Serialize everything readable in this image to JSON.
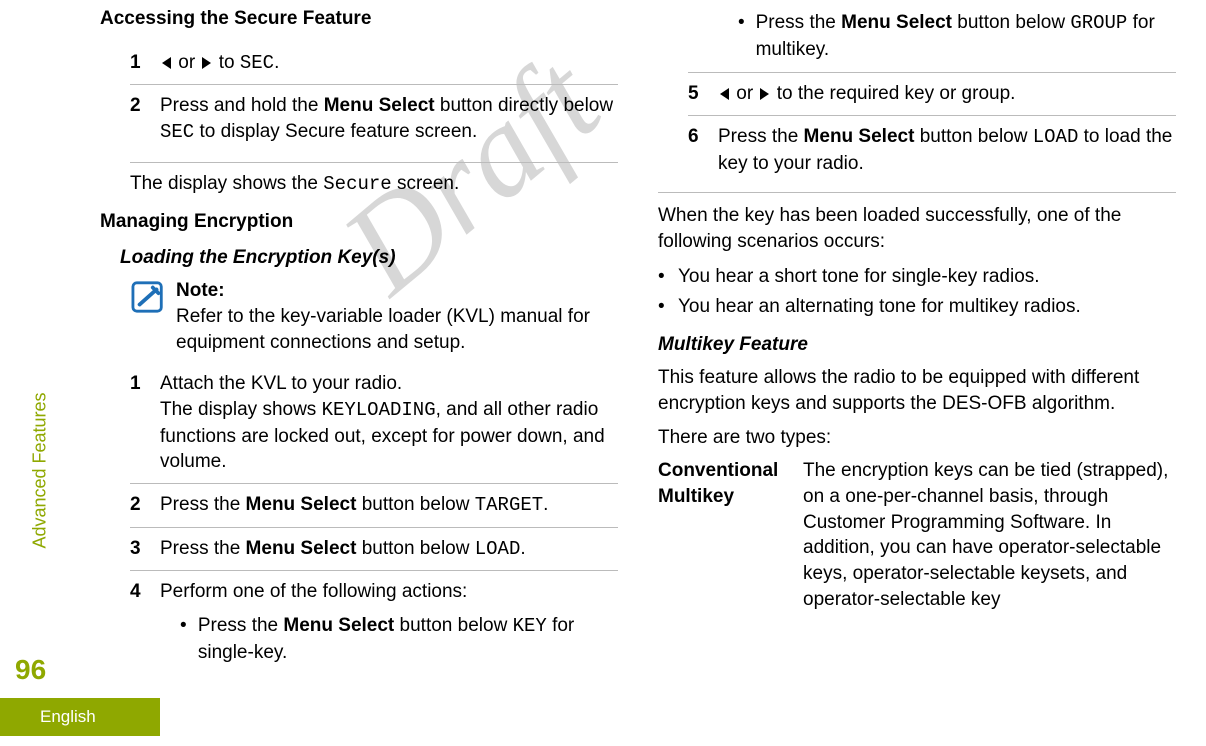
{
  "sidebar": {
    "section_label": "Advanced Features",
    "page_number": "96",
    "language": "English"
  },
  "watermark": "Draft",
  "left": {
    "h_access": "Accessing the Secure Feature",
    "access_steps": [
      {
        "n": "1",
        "pre": "",
        "post_or": " or ",
        "post_to": " to ",
        "code": "SEC",
        "tail": "."
      },
      {
        "n": "2",
        "t1": "Press and hold the ",
        "b1": "Menu Select",
        "t2": " button directly below ",
        "c1": "SEC",
        "t3": " to display Secure feature screen."
      }
    ],
    "access_result_pre": "The display shows the ",
    "access_result_code": "Secure",
    "access_result_post": " screen.",
    "h_manage": "Managing Encryption",
    "h_load": "Loading the Encryption Key(s)",
    "note_title": "Note:",
    "note_body": "Refer to the key-variable loader (KVL) manual for equipment connections and setup.",
    "load_steps": [
      {
        "n": "1",
        "l1": "Attach the KVL to your radio.",
        "l2a": "The display shows ",
        "l2code": "KEYLOADING",
        "l2b": ", and all other radio functions are locked out, except for power down, and volume."
      },
      {
        "n": "2",
        "t1": "Press the ",
        "b1": "Menu Select",
        "t2": " button below ",
        "c1": "TARGET",
        "t3": "."
      },
      {
        "n": "3",
        "t1": "Press the ",
        "b1": "Menu Select",
        "t2": " button below ",
        "c1": "LOAD",
        "t3": "."
      },
      {
        "n": "4",
        "l1": "Perform one of the following actions:",
        "bullets": [
          {
            "t1": "Press the ",
            "b1": "Menu Select",
            "t2": " button below ",
            "c1": "KEY",
            "t3": " for single-key."
          }
        ]
      }
    ]
  },
  "right": {
    "cont_bullet": {
      "t1": "Press the ",
      "b1": "Menu Select",
      "t2": " button below ",
      "c1": "GROUP",
      "t3": " for multikey."
    },
    "steps": [
      {
        "n": "5",
        "post_or": " or ",
        "tail": " to the required key or group."
      },
      {
        "n": "6",
        "t1": "Press the ",
        "b1": "Menu Select",
        "t2": " button below ",
        "c1": "LOAD",
        "t3": " to load the key to your radio."
      }
    ],
    "result_intro": "When the key has been loaded successfully, one of the following scenarios occurs:",
    "result_bullets": [
      "You hear a short tone for single-key radios.",
      "You hear an alternating tone for multikey radios."
    ],
    "h_multikey": "Multikey Feature",
    "multikey_p1": "This feature allows the radio to be equipped with different encryption keys and supports the DES-OFB algorithm.",
    "multikey_p2": "There are two types:",
    "def_term": "Conventional Multikey",
    "def_desc": "The encryption keys can be tied (strapped), on a one-per-channel basis, through Customer Programming Software. In addition, you can have operator-selectable keys, operator-selectable keysets, and operator-selectable key"
  }
}
